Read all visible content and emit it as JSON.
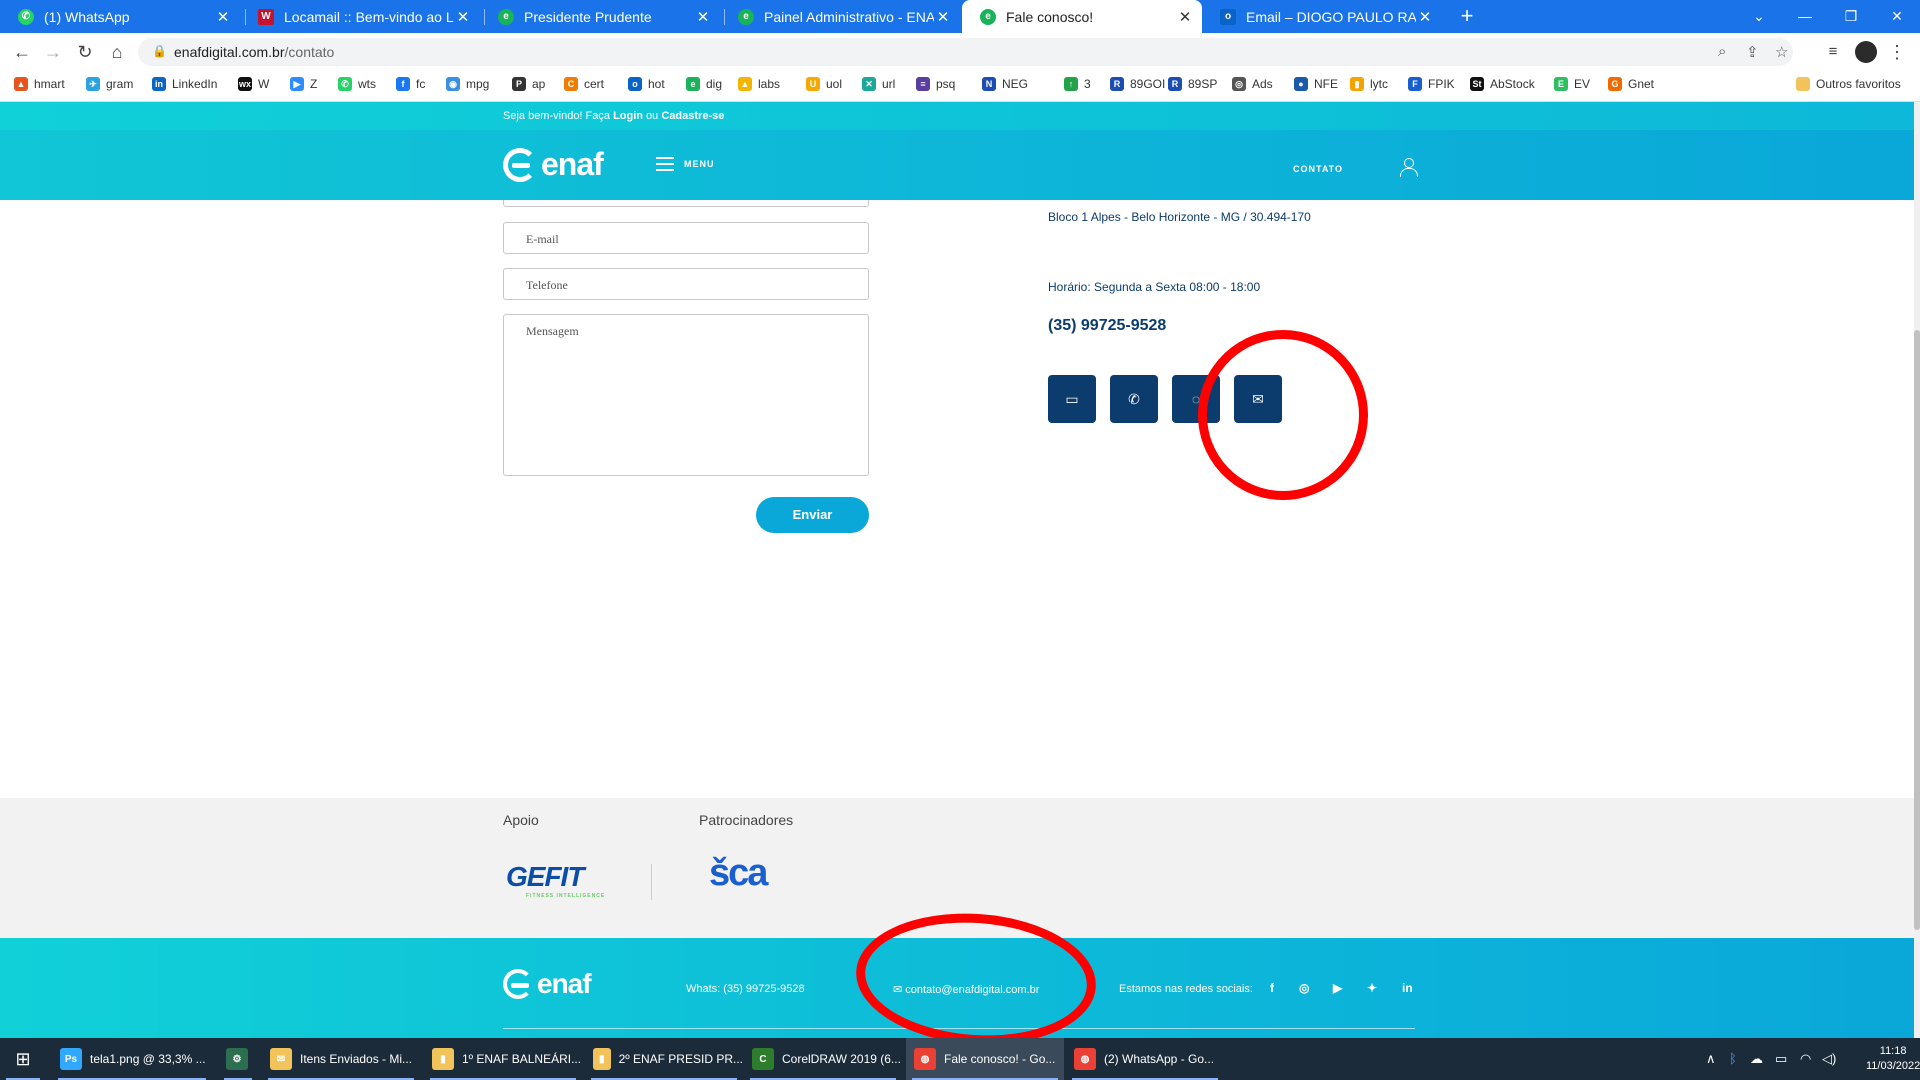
{
  "browser": {
    "tabs": [
      {
        "title": "(1) WhatsApp",
        "favicon": "whatsapp-icon",
        "color": "#25d366",
        "glyph": "✆"
      },
      {
        "title": "Locamail :: Bem-vindo ao Locamail",
        "favicon": "locamail-icon",
        "color": "#c4122f",
        "glyph": "W"
      },
      {
        "title": "Presidente Prudente",
        "favicon": "enaf-icon",
        "color": "#19b35a",
        "glyph": "e"
      },
      {
        "title": "Painel Administrativo - ENAF",
        "favicon": "enaf-icon",
        "color": "#19b35a",
        "glyph": "e"
      },
      {
        "title": "Fale conosco!",
        "favicon": "enaf-icon",
        "color": "#19b35a",
        "glyph": "e"
      },
      {
        "title": "Email – DIOGO PAULO RABELLO",
        "favicon": "outlook-icon",
        "color": "#0a64c8",
        "glyph": "o"
      }
    ],
    "url_domain": "enafdigital.com.br",
    "url_path": "/contato",
    "bookmarks": [
      {
        "label": "hmart",
        "color": "#e8551c",
        "glyph": "▲"
      },
      {
        "label": "gram",
        "color": "#2aa3e0",
        "glyph": "✈"
      },
      {
        "label": "LinkedIn",
        "color": "#0a66c2",
        "glyph": "in"
      },
      {
        "label": "W",
        "color": "#111",
        "glyph": "wx"
      },
      {
        "label": "Z",
        "color": "#2d8cff",
        "glyph": "▶"
      },
      {
        "label": "wts",
        "color": "#25d366",
        "glyph": "✆"
      },
      {
        "label": "fc",
        "color": "#1877f2",
        "glyph": "f"
      },
      {
        "label": "mpg",
        "color": "#3a8ee6",
        "glyph": "◉"
      },
      {
        "label": "ap",
        "color": "#333",
        "glyph": "P"
      },
      {
        "label": "cert",
        "color": "#f07d00",
        "glyph": "C"
      },
      {
        "label": "hot",
        "color": "#0a64c8",
        "glyph": "o"
      },
      {
        "label": "dig",
        "color": "#19b35a",
        "glyph": "e"
      },
      {
        "label": "labs",
        "color": "#f4b400",
        "glyph": "▲"
      },
      {
        "label": "uol",
        "color": "#f6a800",
        "glyph": "U"
      },
      {
        "label": "url",
        "color": "#1aa89a",
        "glyph": "✕"
      },
      {
        "label": "psq",
        "color": "#5b3fa0",
        "glyph": "≡"
      },
      {
        "label": "NEG",
        "color": "#1c4db3",
        "glyph": "N"
      },
      {
        "label": "3",
        "color": "#24a24a",
        "glyph": "↑"
      },
      {
        "label": "89GOI",
        "color": "#1c4db3",
        "glyph": "R"
      },
      {
        "label": "89SP",
        "color": "#1c4db3",
        "glyph": "R"
      },
      {
        "label": "Ads",
        "color": "#555",
        "glyph": "◎"
      },
      {
        "label": "NFE",
        "color": "#1a5aa8",
        "glyph": "●"
      },
      {
        "label": "lytc",
        "color": "#f4a300",
        "glyph": "▮"
      },
      {
        "label": "FPIK",
        "color": "#1a5fd0",
        "glyph": "F"
      },
      {
        "label": "AbStock",
        "color": "#111",
        "glyph": "St"
      },
      {
        "label": "EV",
        "color": "#2dbe60",
        "glyph": "E"
      },
      {
        "label": "Gnet",
        "color": "#f06a00",
        "glyph": "G"
      }
    ],
    "other_bookmarks": "Outros favoritos"
  },
  "site": {
    "welcome_prefix": "Seja bem-vindo! Faça ",
    "login": "Login",
    "or": " ou ",
    "signup": "Cadastre-se",
    "logo_text": "enaf",
    "menu_label": "MENU",
    "contact_link": "CONTATO"
  },
  "form": {
    "email_placeholder": "E-mail",
    "phone_placeholder": "Telefone",
    "message_placeholder": "Mensagem",
    "send_label": "Enviar"
  },
  "contact": {
    "address_line2": "Bloco 1 Alpes - Belo Horizonte - MG / 30.494-170",
    "hours": "Horário: Segunda a Sexta 08:00 - 18:00",
    "phone": "(35) 99725-9528",
    "icons": [
      "chat-icon",
      "phone-icon",
      "whatsapp-icon",
      "mail-icon"
    ]
  },
  "sponsors": {
    "support_heading": "Apoio",
    "sponsors_heading": "Patrocinadores",
    "gefit_name": "GEFIT",
    "gefit_tag": "FITNESS INTELLIGENCE",
    "sca_name": "šca"
  },
  "footer": {
    "logo_text": "enaf",
    "whats": "Whats: (35) 99725-9528",
    "email": "contato@enafdigital.com.br",
    "social_label": "Estamos nas redes sociais:",
    "social_icons": [
      "facebook-icon",
      "instagram-icon",
      "youtube-icon",
      "twitter-icon",
      "linkedin-icon"
    ]
  },
  "taskbar": {
    "items": [
      {
        "label": "tela1.png @ 33,3% ...",
        "icon": "photoshop-icon",
        "color": "#31a8ff",
        "glyph": "Ps"
      },
      {
        "label": "",
        "icon": "app-icon",
        "color": "#2d6e4e",
        "glyph": "⚙"
      },
      {
        "label": "Itens Enviados - Mi...",
        "icon": "mail-app-icon",
        "color": "#f3c35b",
        "glyph": "✉"
      },
      {
        "label": "1º ENAF BALNEÁRI...",
        "icon": "folder-icon",
        "color": "#f3c35b",
        "glyph": "▮"
      },
      {
        "label": "2º ENAF PRESID PR...",
        "icon": "folder-icon",
        "color": "#f3c35b",
        "glyph": "▮"
      },
      {
        "label": "CorelDRAW 2019 (6...",
        "icon": "coreldraw-icon",
        "color": "#2d7d2d",
        "glyph": "C"
      },
      {
        "label": "Fale conosco! - Go...",
        "icon": "chrome-icon",
        "color": "#e94235",
        "glyph": "◍"
      },
      {
        "label": "(2) WhatsApp - Go...",
        "icon": "chrome-icon",
        "color": "#e94235",
        "glyph": "◍"
      }
    ],
    "time": "11:18",
    "date": "11/03/2022"
  }
}
